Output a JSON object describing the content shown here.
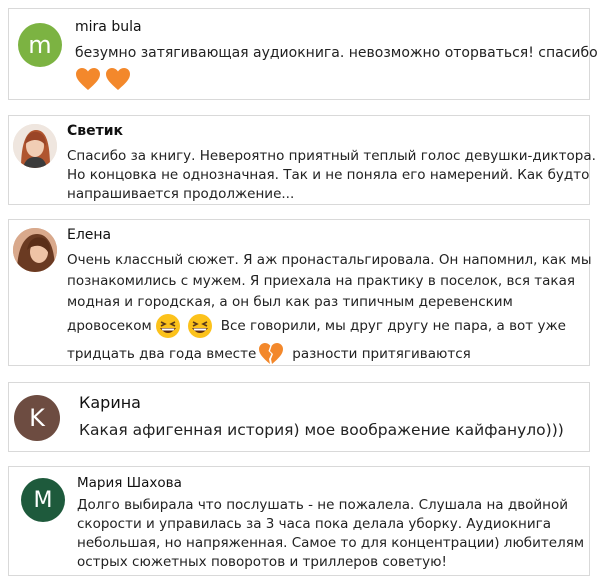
{
  "comments": [
    {
      "author": "mira bula",
      "avatar_letter": "m",
      "avatar_color": "#7cb342",
      "text": "безумно затягивающая аудиокнига. невозможно оторваться! спасибо",
      "emojis": [
        "orange-heart",
        "orange-heart"
      ]
    },
    {
      "author": "Светик",
      "avatar_photo": "woman-portrait",
      "lines": [
        "Спасибо за книгу. Невероятно приятный теплый голос девушки-диктора.",
        "Но концовка не однозначная. Так и не поняла его намерений. Как будто",
        "напрашивается продолжение..."
      ]
    },
    {
      "author": "Елена",
      "avatar_photo": "woman-portrait",
      "lines": [
        "Очень классный сюжет. Я аж пронастальгировала. Он напомнил, как мы",
        "познакомились с мужем. Я приехала на практику в поселок, вся такая",
        "модная и городская, а он был как раз типичным деревенским",
        "дровосеком",
        "Все говорили, мы друг другу не пара, а вот уже",
        "тридцать два года вместе",
        "разности притягиваются"
      ],
      "emojis": [
        "grinning-squinting-face",
        "grinning-squinting-face",
        "broken-heart"
      ]
    },
    {
      "author": "Карина",
      "avatar_letter": "K",
      "avatar_color": "#6d4c41",
      "text": "Какая афигенная история) мое воображение кайфануло)))"
    },
    {
      "author": "Мария Шахова",
      "avatar_letter": "M",
      "avatar_color": "#1e5a3c",
      "lines": [
        "Долго выбирала что послушать - не пожалела. Слушала на двойной",
        "скорости и управилась за 3 часа пока делала уборку. Аудиокнига",
        "небольшая, но напряженная. Самое то для концентрации) любителям",
        "острых сюжетных поворотов и триллеров советую!"
      ]
    }
  ]
}
